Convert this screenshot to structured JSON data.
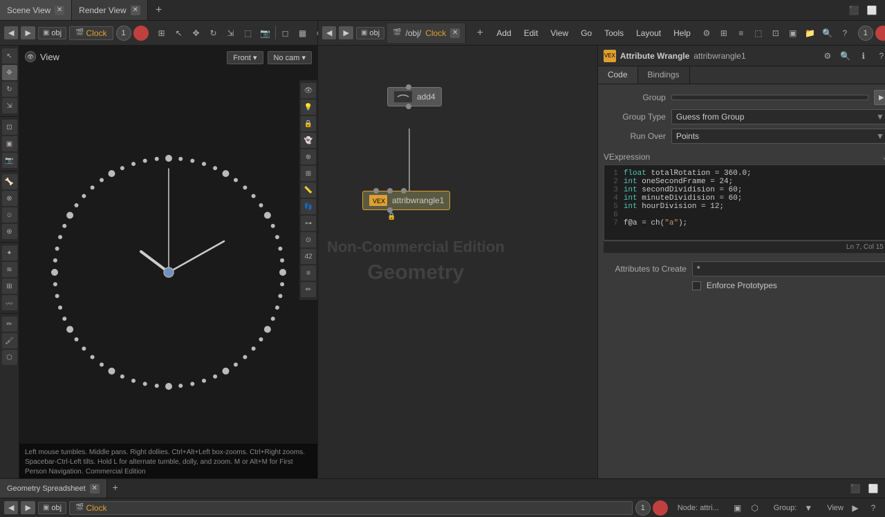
{
  "tabs": [
    {
      "id": "scene-view",
      "label": "Scene View",
      "active": false
    },
    {
      "id": "render-view",
      "label": "Render View",
      "active": false
    }
  ],
  "right_tabs": [
    {
      "id": "network",
      "label": "/obj/Clock",
      "active": true
    }
  ],
  "left_header": {
    "obj_label": "obj",
    "path_label": "Clock",
    "frame": "1"
  },
  "right_header": {
    "obj_label": "obj",
    "path_label": "Clock",
    "frame": "1"
  },
  "view": {
    "label": "View",
    "front_label": "Front ▾",
    "cam_label": "No cam ▾",
    "watermark_line1": "Non-Commercial Edition",
    "watermark_line2": "Geometry"
  },
  "menus": [
    "Add",
    "Edit",
    "View",
    "Go",
    "Tools",
    "Layout",
    "Help"
  ],
  "attrib_wrangle": {
    "title": "Attribute Wrangle",
    "name": "attribwrangle1",
    "tabs": [
      "Code",
      "Bindings"
    ],
    "active_tab": "Code",
    "group_label": "Group",
    "group_type_label": "Group Type",
    "group_type_value": "Guess from Group",
    "run_over_label": "Run Over",
    "run_over_value": "Points",
    "vexpression_label": "VExpression",
    "code_lines": [
      {
        "num": "1",
        "code": "float totalRotation = 360.0;"
      },
      {
        "num": "2",
        "code": "int oneSecondFrame = 24;"
      },
      {
        "num": "3",
        "code": "int secondDividision = 60;"
      },
      {
        "num": "4",
        "code": "int minuteDividision = 60;"
      },
      {
        "num": "5",
        "code": "int hourDivision = 12;"
      },
      {
        "num": "6",
        "code": ""
      },
      {
        "num": "7",
        "code": "f@a = ch(\"a\");"
      }
    ],
    "status": "Ln 7, Col 15",
    "attributes_label": "Attributes to Create",
    "attributes_value": "*",
    "enforce_label": "Enforce Prototypes"
  },
  "nodes": {
    "add4": {
      "label": "add4",
      "type": "add"
    },
    "attribwrangle1": {
      "label": "attribwrangle1",
      "type": "attribwrangle"
    }
  },
  "bottom_tabs": [
    {
      "label": "Geometry Spreadsheet",
      "active": true
    }
  ],
  "bottom_node_status": "Node: attri...",
  "bottom_group_label": "Group:",
  "bottom_view_label": "View",
  "status_text": "Left mouse tumbles. Middle pans. Right dollies. Ctrl+Alt+Left box-zooms. Ctrl+Right zooms. Spacebar-Ctrl-Left tilts. Hold L for alternate tumble, dolly, and zoom. M or Alt+M for First Person Navigation.",
  "watermark_text": "Non-Commercial Edition",
  "int_label": "int"
}
